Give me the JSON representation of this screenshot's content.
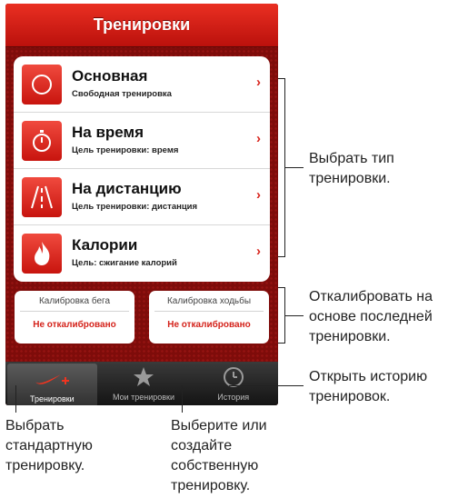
{
  "screen_title": "Тренировки",
  "workouts": [
    {
      "title": "Основная",
      "subtitle": "Свободная тренировка",
      "icon": "circle-icon"
    },
    {
      "title": "На время",
      "subtitle": "Цель тренировки: время",
      "icon": "stopwatch-icon"
    },
    {
      "title": "На дистанцию",
      "subtitle": "Цель тренировки: дистанция",
      "icon": "road-icon"
    },
    {
      "title": "Калории",
      "subtitle": "Цель: сжигание калорий",
      "icon": "flame-icon"
    }
  ],
  "chevron": "›",
  "calibration": {
    "run": {
      "title": "Калибровка бега",
      "status": "Не откалибровано"
    },
    "walk": {
      "title": "Калибровка ходьбы",
      "status": "Не откалибровано"
    }
  },
  "tabs": [
    {
      "label": "Тренировки",
      "icon": "nike-swoosh-plus-icon"
    },
    {
      "label": "Мои тренировки",
      "icon": "star-icon"
    },
    {
      "label": "История",
      "icon": "clock-icon"
    }
  ],
  "callouts": {
    "type": "Выбрать тип\nтренировки.",
    "calibrate": "Откалибровать на\nоснове последней\nтренировки.",
    "history": "Открыть историю\nтренировок.",
    "standard": "Выбрать\nстандартную\nтренировку.",
    "custom": "Выберите или\nсоздайте\nсобственную\nтренировку."
  },
  "colors": {
    "accent": "#d8231b",
    "background": "#7e0c0a",
    "tabbar": "#1e1e1e"
  }
}
